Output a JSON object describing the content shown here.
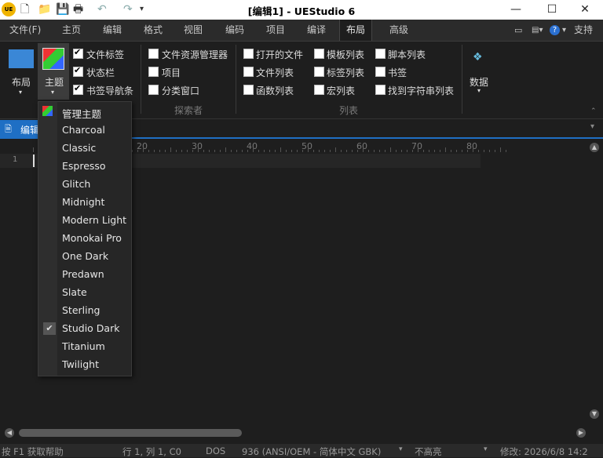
{
  "title_bar": {
    "title": "[编辑1] - UEStudio 6",
    "minimize": "—",
    "maximize": "☐",
    "close": "✕"
  },
  "menu_tabs": [
    "文件(F)",
    "主页",
    "编辑",
    "格式",
    "视图",
    "编码",
    "项目",
    "编译",
    "布局",
    "高级"
  ],
  "menu_right": {
    "support": "支持",
    "help": "?"
  },
  "ribbon": {
    "layout_label": "布局",
    "theme_label": "主题",
    "layout_checks": [
      {
        "label": "文件标签",
        "checked": true
      },
      {
        "label": "状态栏",
        "checked": true
      },
      {
        "label": "书签导航条",
        "checked": true
      }
    ],
    "explorer_checks": [
      {
        "label": "文件资源管理器",
        "checked": false
      },
      {
        "label": "项目",
        "checked": false
      },
      {
        "label": "分类窗口",
        "checked": false
      }
    ],
    "explorer_group": "探索者",
    "list_col1": [
      {
        "label": "打开的文件",
        "checked": false
      },
      {
        "label": "文件列表",
        "checked": false
      },
      {
        "label": "函数列表",
        "checked": false
      }
    ],
    "list_col2": [
      {
        "label": "模板列表",
        "checked": false
      },
      {
        "label": "标签列表",
        "checked": false
      },
      {
        "label": "宏列表",
        "checked": false
      }
    ],
    "list_col3": [
      {
        "label": "脚本列表",
        "checked": false
      },
      {
        "label": "书签",
        "checked": false
      },
      {
        "label": "找到字符串列表",
        "checked": false
      }
    ],
    "list_group": "列表",
    "data_label": "数据"
  },
  "document_tab": "编辑",
  "ruler_labels": [
    "20",
    "30",
    "40",
    "50",
    "60",
    "70",
    "80"
  ],
  "line_number": "1",
  "theme_menu": {
    "manage": "管理主题",
    "themes": [
      "Charcoal",
      "Classic",
      "Espresso",
      "Glitch",
      "Midnight",
      "Modern Light",
      "Monokai Pro",
      "One Dark",
      "Predawn",
      "Slate",
      "Sterling",
      "Studio Dark",
      "Titanium",
      "Twilight"
    ],
    "selected": "Studio Dark"
  },
  "status_bar": {
    "help": "按 F1 获取帮助",
    "position": "行 1, 列 1, C0",
    "line_ending": "DOS",
    "encoding": "936  (ANSI/OEM - 简体中文 GBK)",
    "highlight": "不高亮",
    "modified": "修改:   2026/6/8 14:2"
  },
  "colors": {
    "accent": "#1f6fc4",
    "background": "#1e1e1e",
    "menu_bg": "#262626"
  }
}
